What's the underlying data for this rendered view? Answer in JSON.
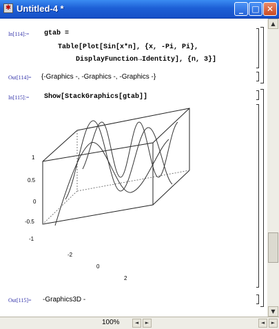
{
  "window": {
    "title": "Untitled-4 *"
  },
  "cells": {
    "in114_label": "In[114]:=",
    "in114_code": [
      "gtab =",
      "Table[Plot[Sin[x*n], {x, -Pi, Pi},",
      "DisplayFunction→Identity], {n, 3}]"
    ],
    "out114_label": "Out[114]=",
    "out114_text": "{-Graphics -, -Graphics -, -Graphics -}",
    "in115_label": "In[115]:=",
    "in115_code": "Show[StackGraphics[gtab]]",
    "out115_label": "Out[115]=",
    "out115_text": "-Graphics3D -"
  },
  "plot": {
    "z_ticks": [
      "1",
      "0.5",
      "0",
      "-0.5",
      "-1"
    ],
    "x_ticks": [
      "-2",
      "0",
      "2"
    ]
  },
  "statusbar": {
    "zoom": "100%"
  },
  "colors": {
    "titlebar": "#1d5fd6",
    "label": "#3333aa"
  }
}
